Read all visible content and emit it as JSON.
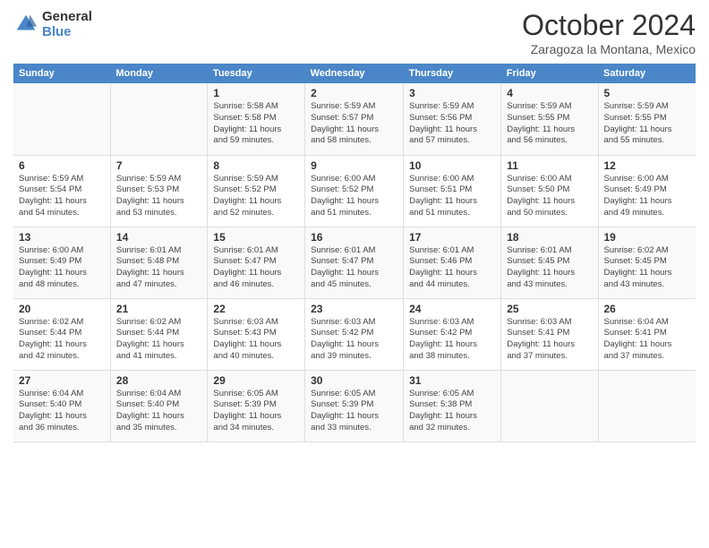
{
  "header": {
    "logo_line1": "General",
    "logo_line2": "Blue",
    "month": "October 2024",
    "location": "Zaragoza la Montana, Mexico"
  },
  "weekdays": [
    "Sunday",
    "Monday",
    "Tuesday",
    "Wednesday",
    "Thursday",
    "Friday",
    "Saturday"
  ],
  "weeks": [
    [
      {
        "day": "",
        "info": ""
      },
      {
        "day": "",
        "info": ""
      },
      {
        "day": "1",
        "info": "Sunrise: 5:58 AM\nSunset: 5:58 PM\nDaylight: 11 hours\nand 59 minutes."
      },
      {
        "day": "2",
        "info": "Sunrise: 5:59 AM\nSunset: 5:57 PM\nDaylight: 11 hours\nand 58 minutes."
      },
      {
        "day": "3",
        "info": "Sunrise: 5:59 AM\nSunset: 5:56 PM\nDaylight: 11 hours\nand 57 minutes."
      },
      {
        "day": "4",
        "info": "Sunrise: 5:59 AM\nSunset: 5:55 PM\nDaylight: 11 hours\nand 56 minutes."
      },
      {
        "day": "5",
        "info": "Sunrise: 5:59 AM\nSunset: 5:55 PM\nDaylight: 11 hours\nand 55 minutes."
      }
    ],
    [
      {
        "day": "6",
        "info": "Sunrise: 5:59 AM\nSunset: 5:54 PM\nDaylight: 11 hours\nand 54 minutes."
      },
      {
        "day": "7",
        "info": "Sunrise: 5:59 AM\nSunset: 5:53 PM\nDaylight: 11 hours\nand 53 minutes."
      },
      {
        "day": "8",
        "info": "Sunrise: 5:59 AM\nSunset: 5:52 PM\nDaylight: 11 hours\nand 52 minutes."
      },
      {
        "day": "9",
        "info": "Sunrise: 6:00 AM\nSunset: 5:52 PM\nDaylight: 11 hours\nand 51 minutes."
      },
      {
        "day": "10",
        "info": "Sunrise: 6:00 AM\nSunset: 5:51 PM\nDaylight: 11 hours\nand 51 minutes."
      },
      {
        "day": "11",
        "info": "Sunrise: 6:00 AM\nSunset: 5:50 PM\nDaylight: 11 hours\nand 50 minutes."
      },
      {
        "day": "12",
        "info": "Sunrise: 6:00 AM\nSunset: 5:49 PM\nDaylight: 11 hours\nand 49 minutes."
      }
    ],
    [
      {
        "day": "13",
        "info": "Sunrise: 6:00 AM\nSunset: 5:49 PM\nDaylight: 11 hours\nand 48 minutes."
      },
      {
        "day": "14",
        "info": "Sunrise: 6:01 AM\nSunset: 5:48 PM\nDaylight: 11 hours\nand 47 minutes."
      },
      {
        "day": "15",
        "info": "Sunrise: 6:01 AM\nSunset: 5:47 PM\nDaylight: 11 hours\nand 46 minutes."
      },
      {
        "day": "16",
        "info": "Sunrise: 6:01 AM\nSunset: 5:47 PM\nDaylight: 11 hours\nand 45 minutes."
      },
      {
        "day": "17",
        "info": "Sunrise: 6:01 AM\nSunset: 5:46 PM\nDaylight: 11 hours\nand 44 minutes."
      },
      {
        "day": "18",
        "info": "Sunrise: 6:01 AM\nSunset: 5:45 PM\nDaylight: 11 hours\nand 43 minutes."
      },
      {
        "day": "19",
        "info": "Sunrise: 6:02 AM\nSunset: 5:45 PM\nDaylight: 11 hours\nand 43 minutes."
      }
    ],
    [
      {
        "day": "20",
        "info": "Sunrise: 6:02 AM\nSunset: 5:44 PM\nDaylight: 11 hours\nand 42 minutes."
      },
      {
        "day": "21",
        "info": "Sunrise: 6:02 AM\nSunset: 5:44 PM\nDaylight: 11 hours\nand 41 minutes."
      },
      {
        "day": "22",
        "info": "Sunrise: 6:03 AM\nSunset: 5:43 PM\nDaylight: 11 hours\nand 40 minutes."
      },
      {
        "day": "23",
        "info": "Sunrise: 6:03 AM\nSunset: 5:42 PM\nDaylight: 11 hours\nand 39 minutes."
      },
      {
        "day": "24",
        "info": "Sunrise: 6:03 AM\nSunset: 5:42 PM\nDaylight: 11 hours\nand 38 minutes."
      },
      {
        "day": "25",
        "info": "Sunrise: 6:03 AM\nSunset: 5:41 PM\nDaylight: 11 hours\nand 37 minutes."
      },
      {
        "day": "26",
        "info": "Sunrise: 6:04 AM\nSunset: 5:41 PM\nDaylight: 11 hours\nand 37 minutes."
      }
    ],
    [
      {
        "day": "27",
        "info": "Sunrise: 6:04 AM\nSunset: 5:40 PM\nDaylight: 11 hours\nand 36 minutes."
      },
      {
        "day": "28",
        "info": "Sunrise: 6:04 AM\nSunset: 5:40 PM\nDaylight: 11 hours\nand 35 minutes."
      },
      {
        "day": "29",
        "info": "Sunrise: 6:05 AM\nSunset: 5:39 PM\nDaylight: 11 hours\nand 34 minutes."
      },
      {
        "day": "30",
        "info": "Sunrise: 6:05 AM\nSunset: 5:39 PM\nDaylight: 11 hours\nand 33 minutes."
      },
      {
        "day": "31",
        "info": "Sunrise: 6:05 AM\nSunset: 5:38 PM\nDaylight: 11 hours\nand 32 minutes."
      },
      {
        "day": "",
        "info": ""
      },
      {
        "day": "",
        "info": ""
      }
    ]
  ]
}
